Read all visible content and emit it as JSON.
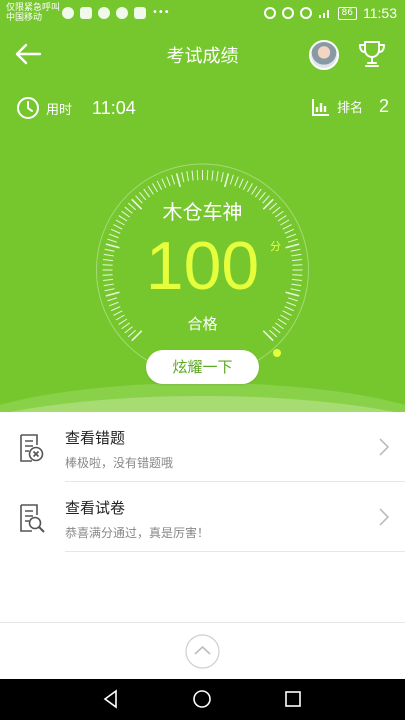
{
  "status_bar": {
    "carrier_line1": "仅限紧急呼叫",
    "carrier_line2": "中国移动",
    "battery": "86",
    "time": "11:53"
  },
  "header": {
    "title": "考试成绩",
    "back_icon": "arrow-left-icon",
    "trophy_icon": "trophy-icon"
  },
  "stats": {
    "time_label": "用时",
    "time_value": "11:04",
    "rank_label": "排名",
    "rank_value": "2"
  },
  "result": {
    "title": "木仓车神",
    "score": "100",
    "score_unit": "分",
    "status": "合格",
    "share_button": "炫耀一下"
  },
  "menu": [
    {
      "title": "查看错题",
      "subtitle": "棒极啦，没有错题哦",
      "icon": "wrong-answers-icon"
    },
    {
      "title": "查看试卷",
      "subtitle": "恭喜满分通过，真是厉害！",
      "icon": "exam-paper-icon"
    }
  ],
  "colors": {
    "primary_green": "#76c72e",
    "score_yellow": "#e6ff3c",
    "button_text_green": "#5aaa20"
  }
}
